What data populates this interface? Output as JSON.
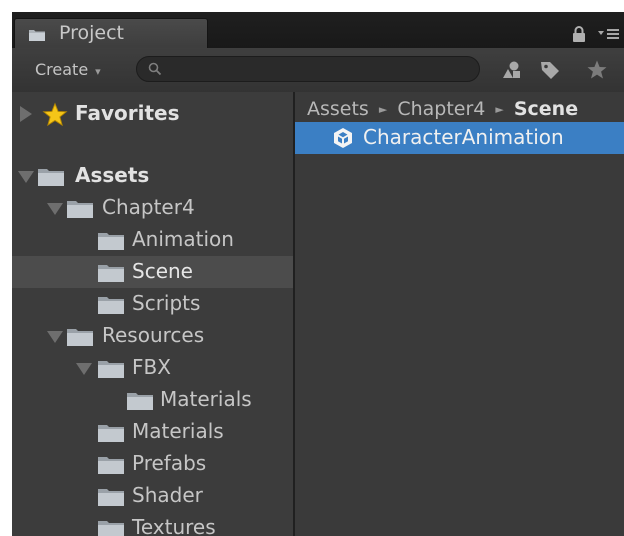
{
  "panel": {
    "tab_label": "Project",
    "tab_icon": "folder-icon",
    "lock_icon": "lock-icon",
    "menu_icon": "panel-menu-icon"
  },
  "toolbar": {
    "create_label": "Create",
    "create_arrow": "▾",
    "search_placeholder": "",
    "icons": [
      "filter-by-type-icon",
      "filter-by-label-icon",
      "favorites-star-icon"
    ]
  },
  "tree": {
    "favorites": "Favorites",
    "assets": "Assets",
    "chapter4": "Chapter4",
    "animation": "Animation",
    "scene": "Scene",
    "scripts": "Scripts",
    "resources": "Resources",
    "fbx": "FBX",
    "fbx_materials": "Materials",
    "materials": "Materials",
    "prefabs": "Prefabs",
    "shader": "Shader",
    "textures": "Textures",
    "selected": "Scene"
  },
  "breadcrumb": {
    "items": [
      "Assets",
      "Chapter4",
      "Scene"
    ],
    "separator": "►"
  },
  "content": {
    "items": [
      {
        "label": "CharacterAnimation",
        "icon": "unity-scene-icon",
        "selected": true
      }
    ]
  },
  "colors": {
    "selection_blue": "#3b7fc4",
    "panel_bg": "#3c3c3c",
    "star_yellow": "#f5c518"
  }
}
